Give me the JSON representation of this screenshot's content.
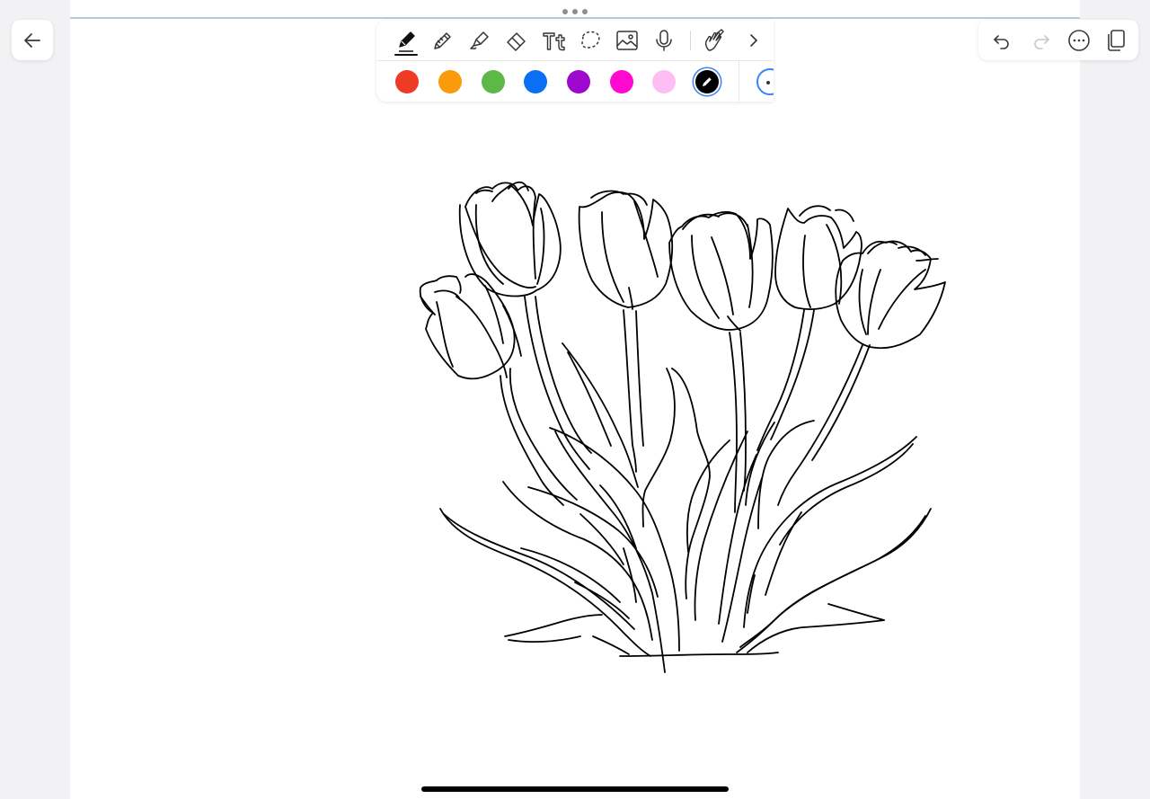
{
  "toolbar": {
    "tools": [
      {
        "name": "pen",
        "icon": "pen-icon",
        "selected": true
      },
      {
        "name": "pencil",
        "icon": "pencil-icon"
      },
      {
        "name": "highlighter",
        "icon": "highlighter-icon"
      },
      {
        "name": "eraser",
        "icon": "eraser-icon"
      },
      {
        "name": "text",
        "icon": "text-tool-icon"
      },
      {
        "name": "lasso",
        "icon": "lasso-icon"
      },
      {
        "name": "image",
        "icon": "image-icon"
      },
      {
        "name": "microphone",
        "icon": "microphone-icon"
      },
      {
        "name": "touch-draw",
        "icon": "hand-pen-icon"
      },
      {
        "name": "more-tools",
        "icon": "chevron-right-icon"
      }
    ],
    "colors": [
      {
        "name": "red",
        "hex": "#ef3b26"
      },
      {
        "name": "orange",
        "hex": "#fb9b0b"
      },
      {
        "name": "green",
        "hex": "#5cb947"
      },
      {
        "name": "blue",
        "hex": "#0a70f3"
      },
      {
        "name": "purple",
        "hex": "#9e08cc"
      },
      {
        "name": "magenta",
        "hex": "#ff08cf"
      },
      {
        "name": "pink",
        "hex": "#ffbef3"
      },
      {
        "name": "black",
        "hex": "#000000",
        "selected": true
      }
    ],
    "stroke_size": "selected"
  },
  "top_right": {
    "actions": [
      {
        "name": "undo",
        "icon": "undo-icon"
      },
      {
        "name": "redo",
        "icon": "redo-icon",
        "disabled": true
      },
      {
        "name": "more",
        "icon": "ellipsis-circle-icon"
      },
      {
        "name": "pages",
        "icon": "pages-icon"
      }
    ]
  },
  "navigation": {
    "back_icon": "back-arrow-icon"
  },
  "canvas": {
    "accent": "#b9c9df",
    "ink": "#000000"
  }
}
